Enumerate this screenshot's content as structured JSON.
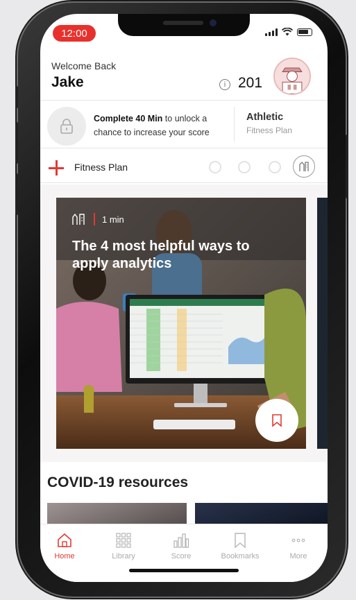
{
  "status_bar": {
    "time": "12:00"
  },
  "header": {
    "greeting": "Welcome Back",
    "user_name": "Jake",
    "score": "201"
  },
  "unlock_banner": {
    "bold_text": "Complete 40 Min",
    "rest_text": " to unlock a chance to increase your score",
    "plan_title": "Athletic",
    "plan_subtitle": "Fitness Plan"
  },
  "plan_bar": {
    "label": "Fitness Plan"
  },
  "feature_card": {
    "duration": "1 min",
    "title": "The 4 most helpful ways to apply analytics"
  },
  "section": {
    "title": "COVID-19 resources"
  },
  "tabbar": {
    "items": [
      {
        "label": "Home",
        "icon": "home-icon",
        "active": true
      },
      {
        "label": "Library",
        "icon": "grid-icon"
      },
      {
        "label": "Score",
        "icon": "bar-chart-icon"
      },
      {
        "label": "Bookmarks",
        "icon": "bookmark-icon"
      },
      {
        "label": "More",
        "icon": "more-icon"
      }
    ]
  },
  "colors": {
    "accent": "#e13a33"
  }
}
